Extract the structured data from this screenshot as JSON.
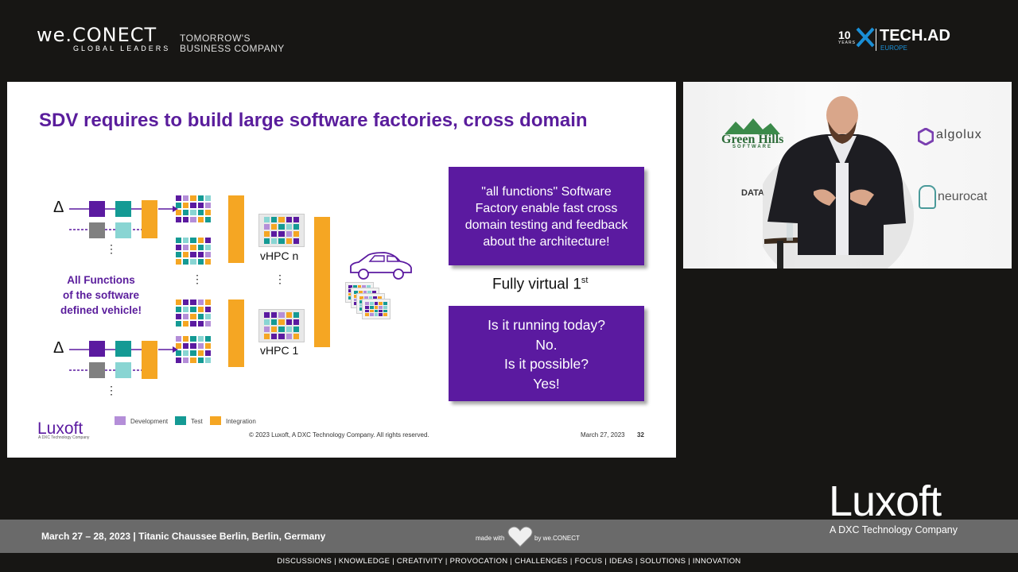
{
  "branding": {
    "weconect_logo": "we.CONECT",
    "weconect_sub": "GLOBAL LEADERS",
    "tagline_line1": "TOMORROW'S",
    "tagline_line2": "BUSINESS COMPANY",
    "techad_ten": "10",
    "techad_years": "YEARS",
    "techad_name": "TECH.AD",
    "techad_region": "EUROPE"
  },
  "slide": {
    "title": "SDV requires to build large software factories, cross domain",
    "delta": "Δ",
    "dots": "⋮",
    "all_functions": [
      "All Functions",
      "of the software",
      "defined vehicle!"
    ],
    "vhpc_n": "vHPC n",
    "vhpc_1": "vHPC 1",
    "box_top": [
      "\"all functions\" Software",
      "Factory enable fast cross",
      "domain testing and feedback",
      "about the architecture!"
    ],
    "fully_virtual": "Fully virtual 1",
    "fully_virtual_sup": "st",
    "box_bottom": [
      "Is it running today?",
      "No.",
      "Is it possible?",
      "Yes!"
    ],
    "legend": [
      "Development",
      "Test",
      "Integration"
    ],
    "copyright": "© 2023 Luxoft, A DXC Technology Company. All rights reserved.",
    "date": "March 27, 2023",
    "page": "32",
    "luxoft_logo": "Luxoft",
    "luxoft_sub": "A DXC Technology Company",
    "colors": {
      "purple": "#5b1aa0",
      "teal": "#149a94",
      "orange": "#f5a623",
      "title": "#5a1d9c"
    }
  },
  "video": {
    "sponsors": [
      "Green Hills",
      "SOFTWARE",
      "algolux",
      "neurocat",
      "DATA"
    ]
  },
  "bottom": {
    "luxoft_big": "Luxoft",
    "luxoft_big_sub": "A DXC Technology Company",
    "event_info": "March 27 – 28, 2023 | Titanic Chaussee Berlin, Berlin, Germany",
    "made_with": "made with",
    "by_conect": "by we.CONECT",
    "footer_nav": "DISCUSSIONS | KNOWLEDGE | CREATIVITY | PROVOCATION | CHALLENGES | FOCUS | IDEAS | SOLUTIONS | INNOVATION"
  }
}
